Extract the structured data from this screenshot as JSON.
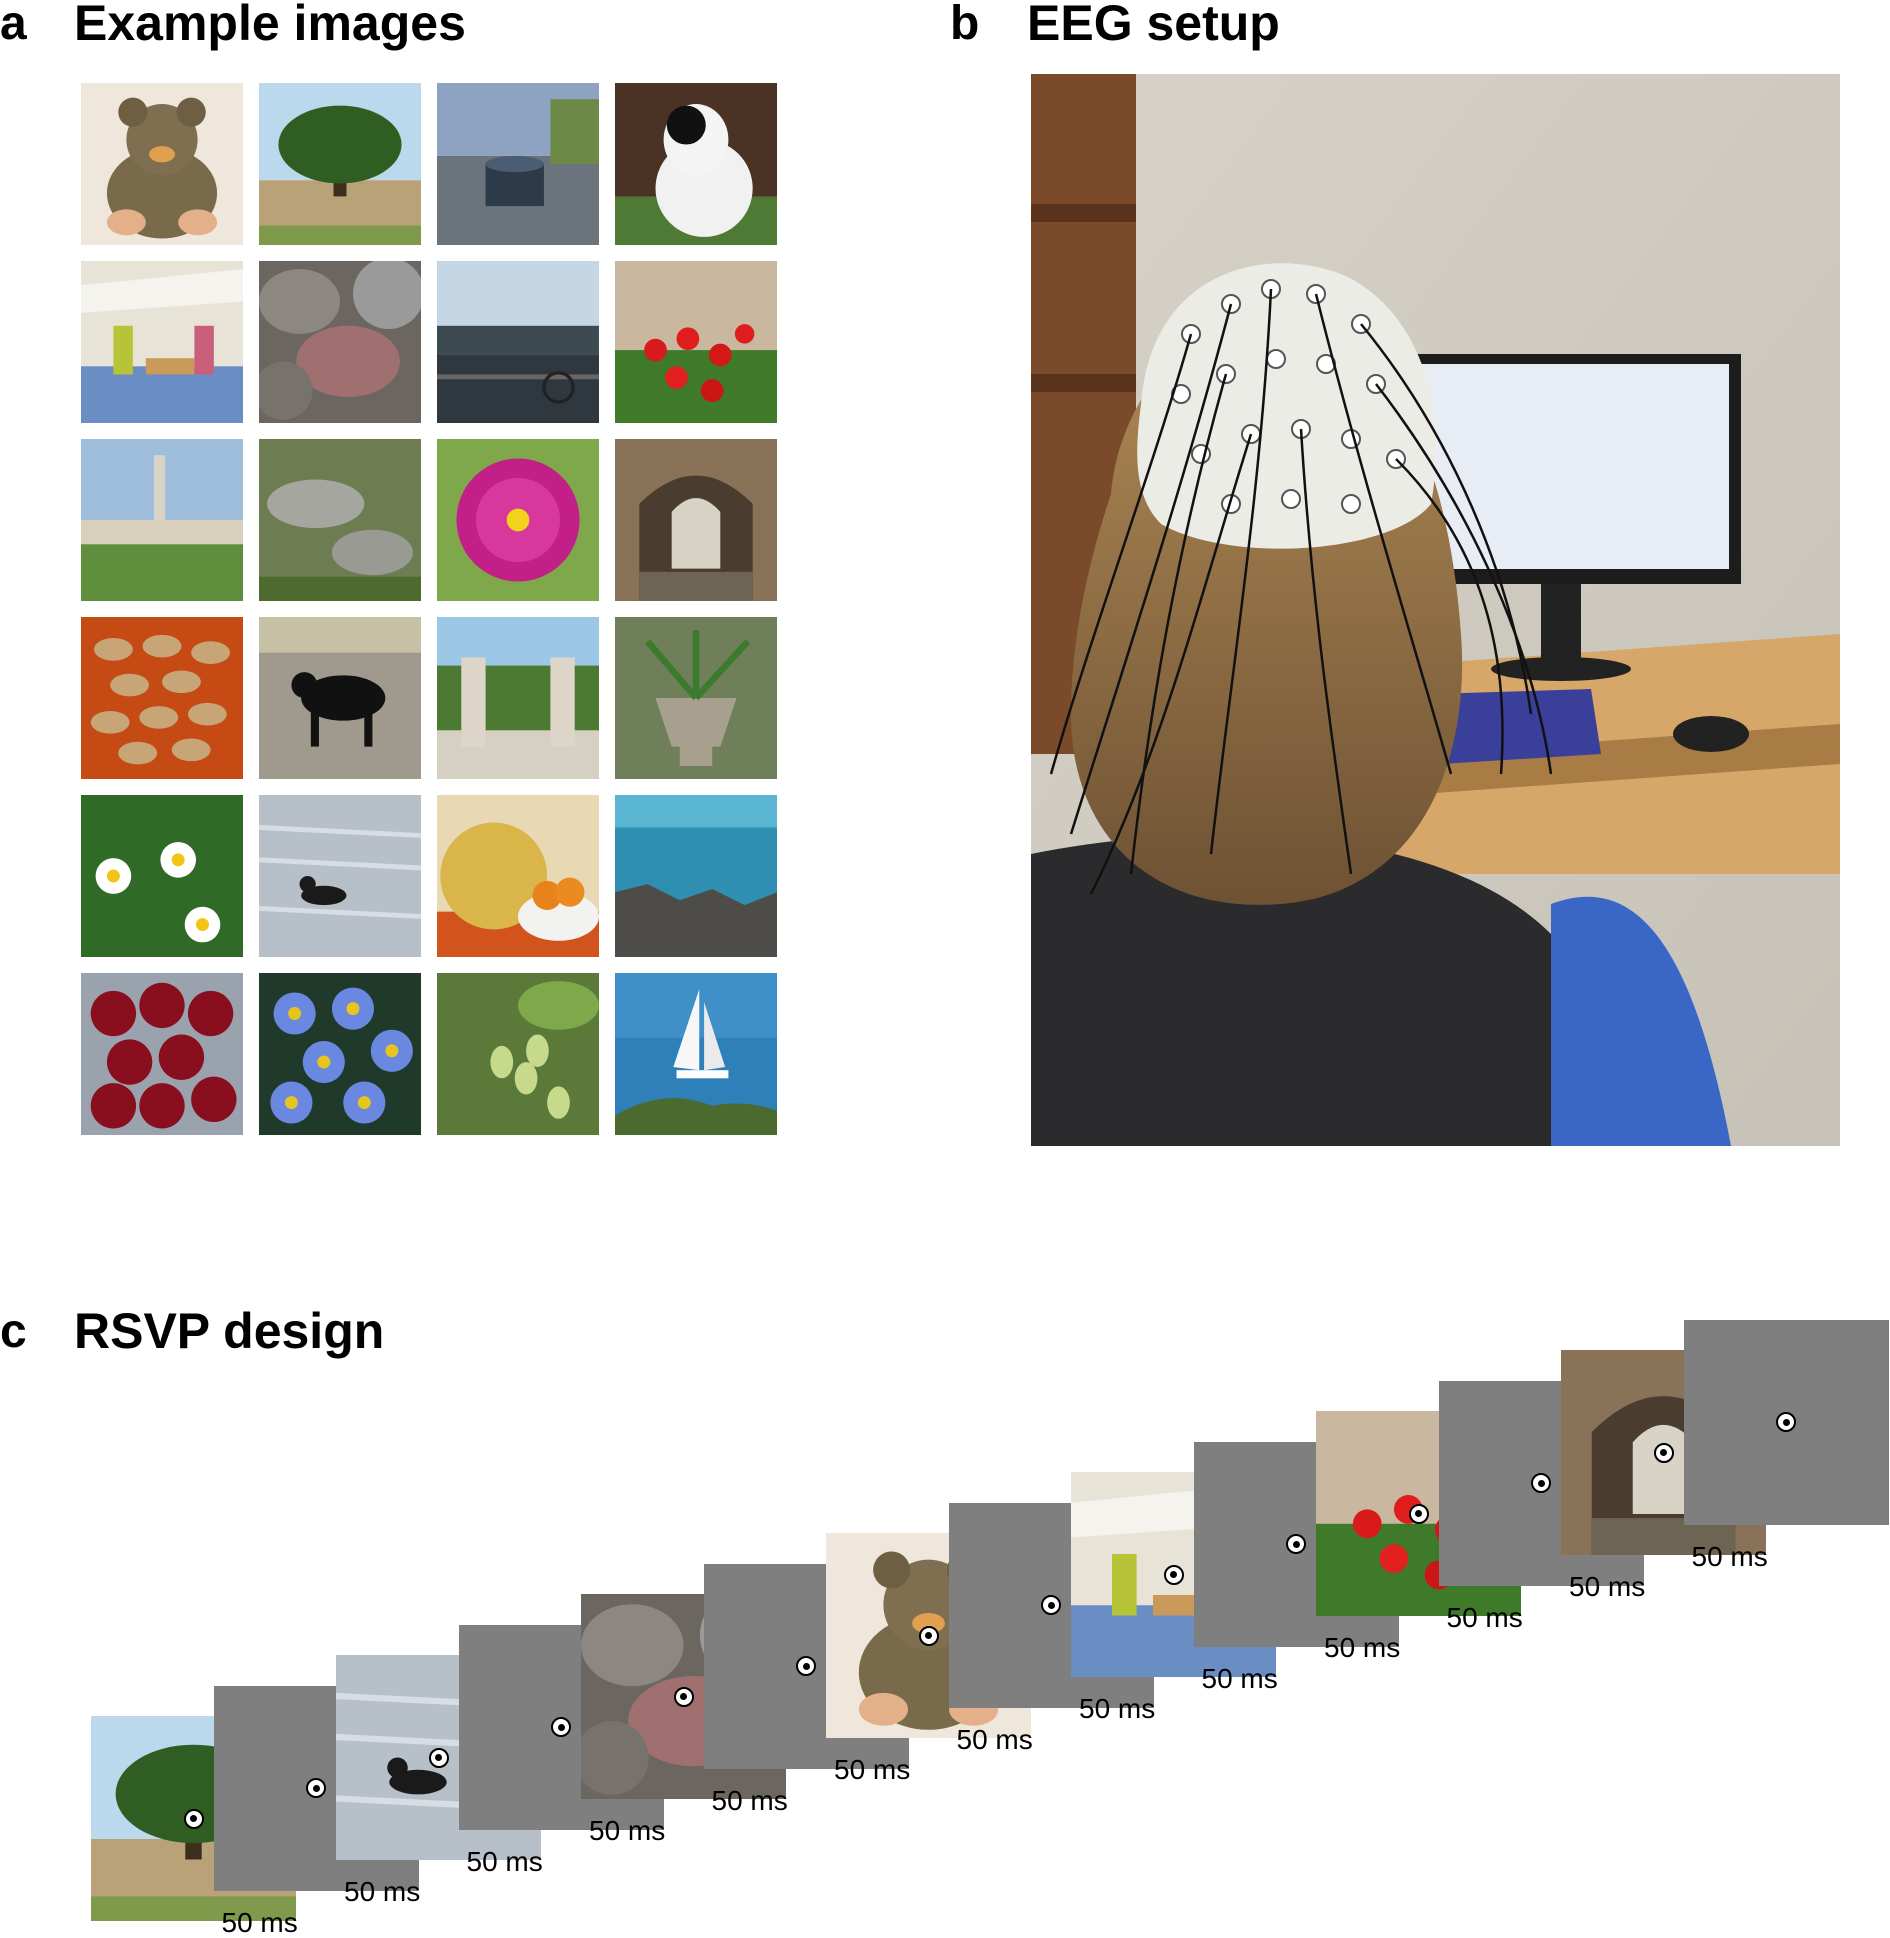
{
  "panels": {
    "a": {
      "letter": "a",
      "title": "Example images"
    },
    "b": {
      "letter": "b",
      "title": "EEG setup"
    },
    "c": {
      "letter": "c",
      "title": "RSVP design"
    }
  },
  "example_images": [
    "teddy-bear",
    "tree",
    "bollard-by-water",
    "dog",
    "market-stall",
    "rocks",
    "harbor-city",
    "red-flowers-wall",
    "plaza-column",
    "rocky-plants",
    "pink-dahlia",
    "stone-tunnel",
    "peanuts",
    "black-cow",
    "garden-gate",
    "stone-urn-plant",
    "daisies",
    "duck-on-water",
    "melon-and-oranges",
    "rocky-coast",
    "cherries",
    "blue-asters",
    "green-berries",
    "sailboat"
  ],
  "rsvp": {
    "duration_label": "50 ms",
    "sequence": [
      "tree",
      "blank",
      "duck-on-water",
      "blank",
      "rocks",
      "blank",
      "teddy-bear",
      "blank",
      "market-stall",
      "blank",
      "red-flowers-wall",
      "blank",
      "stone-tunnel",
      "blank"
    ]
  },
  "colors": {
    "blank_screen": "#7f7f7f",
    "fixation_dot": "#000000"
  }
}
